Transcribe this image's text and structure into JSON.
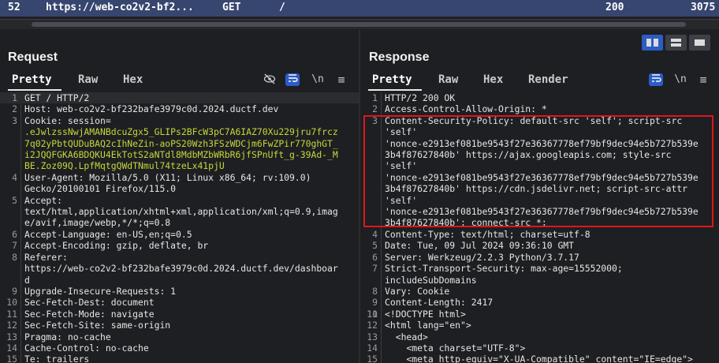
{
  "history_row": {
    "num": "52",
    "url": "https://web-co2v2-bf2...",
    "method": "GET",
    "path": "/",
    "status": "200",
    "length": "3075"
  },
  "request": {
    "title": "Request",
    "tabs": [
      "Pretty",
      "Raw",
      "Hex"
    ],
    "active_tab": "Pretty",
    "lines": [
      {
        "n": "1",
        "t": "GET / HTTP/2"
      },
      {
        "n": "2",
        "t": "Host: web-co2v2-bf232bafe3979c0d.2024.ductf.dev"
      },
      {
        "n": "3",
        "t": "Cookie: session="
      },
      {
        "n": "",
        "t": ".eJwlzssNwjAMANBdcuZgx5_GLIPs2BFcW3pC7A6IAZ70Xu229jru7frcz",
        "c": true
      },
      {
        "n": "",
        "t": "7q02yPbtQUDuBAQ2cIhNeZin-aoPS20Wzh3FSzWDCjm6FwZPir770ghGT_",
        "c": true
      },
      {
        "n": "",
        "t": "i2JQQFGKA6BDQKU4EkTotS2aNTdl8MdbMZbWRbR6jfSPnUft_g-39Ad-_M",
        "c": true
      },
      {
        "n": "",
        "t": "BE.Zoz09Q.LpfMqtgQWdTNmul74tzeLx41pjU",
        "c": true
      },
      {
        "n": "4",
        "t": "User-Agent: Mozilla/5.0 (X11; Linux x86_64; rv:109.0)"
      },
      {
        "n": "",
        "t": "Gecko/20100101 Firefox/115.0"
      },
      {
        "n": "5",
        "t": "Accept:"
      },
      {
        "n": "",
        "t": "text/html,application/xhtml+xml,application/xml;q=0.9,imag"
      },
      {
        "n": "",
        "t": "e/avif,image/webp,*/*;q=0.8"
      },
      {
        "n": "6",
        "t": "Accept-Language: en-US,en;q=0.5"
      },
      {
        "n": "7",
        "t": "Accept-Encoding: gzip, deflate, br"
      },
      {
        "n": "8",
        "t": "Referer:"
      },
      {
        "n": "",
        "t": "https://web-co2v2-bf232bafe3979c0d.2024.ductf.dev/dashboar"
      },
      {
        "n": "",
        "t": "d"
      },
      {
        "n": "9",
        "t": "Upgrade-Insecure-Requests: 1"
      },
      {
        "n": "10",
        "t": "Sec-Fetch-Dest: document"
      },
      {
        "n": "11",
        "t": "Sec-Fetch-Mode: navigate"
      },
      {
        "n": "12",
        "t": "Sec-Fetch-Site: same-origin"
      },
      {
        "n": "13",
        "t": "Pragma: no-cache"
      },
      {
        "n": "14",
        "t": "Cache-Control: no-cache"
      },
      {
        "n": "15",
        "t": "Te: trailers"
      }
    ]
  },
  "response": {
    "title": "Response",
    "tabs": [
      "Pretty",
      "Raw",
      "Hex",
      "Render"
    ],
    "active_tab": "Pretty",
    "lines": [
      {
        "n": "1",
        "t": "HTTP/2 200 OK"
      },
      {
        "n": "2",
        "t": "Access-Control-Allow-Origin: *"
      },
      {
        "n": "3",
        "t": "Content-Security-Policy: default-src 'self'; script-src"
      },
      {
        "n": "",
        "t": "'self'"
      },
      {
        "n": "",
        "t": "'nonce-e2913ef081be9543f27e36367778ef79bf9dec94e5b727b539e"
      },
      {
        "n": "",
        "t": "3b4f87627840b' https://ajax.googleapis.com; style-src"
      },
      {
        "n": "",
        "t": "'self'"
      },
      {
        "n": "",
        "t": "'nonce-e2913ef081be9543f27e36367778ef79bf9dec94e5b727b539e"
      },
      {
        "n": "",
        "t": "3b4f87627840b' https://cdn.jsdelivr.net; script-src-attr"
      },
      {
        "n": "",
        "t": "'self'"
      },
      {
        "n": "",
        "t": "'nonce-e2913ef081be9543f27e36367778ef79bf9dec94e5b727b539e"
      },
      {
        "n": "",
        "t": "3b4f87627840b'; connect-src *;"
      },
      {
        "n": "4",
        "t": "Content-Type: text/html; charset=utf-8"
      },
      {
        "n": "5",
        "t": "Date: Tue, 09 Jul 2024 09:36:10 GMT"
      },
      {
        "n": "6",
        "t": "Server: Werkzeug/2.2.3 Python/3.7.17"
      },
      {
        "n": "7",
        "t": "Strict-Transport-Security: max-age=15552000;"
      },
      {
        "n": "",
        "t": "includeSubDomains"
      },
      {
        "n": "8",
        "t": "Vary: Cookie"
      },
      {
        "n": "9",
        "t": "Content-Length: 2417"
      },
      {
        "n": "10",
        "t": ""
      },
      {
        "n": "11",
        "t": "<!DOCTYPE html>"
      },
      {
        "n": "12",
        "t": "<html lang=\"en\">"
      },
      {
        "n": "13",
        "t": "  <head>"
      },
      {
        "n": "14",
        "t": "    <meta charset=\"UTF-8\">"
      },
      {
        "n": "15",
        "t": "    <meta http-equiv=\"X-UA-Compatible\" content=\"IE=edge\">"
      }
    ]
  },
  "toolbar": {
    "request_icons": [
      "eye-slash-icon",
      "wrap-icon",
      "newline-icon",
      "menu-icon"
    ],
    "response_icons": [
      "wrap-icon",
      "newline-icon",
      "menu-icon"
    ],
    "newline_label": "\\n",
    "menu_label": "≡"
  },
  "colors": {
    "accent": "#2c5cc5",
    "history_row": "#37466f",
    "highlight_box": "#e0161b",
    "cookie_value": "#c8d63a"
  }
}
